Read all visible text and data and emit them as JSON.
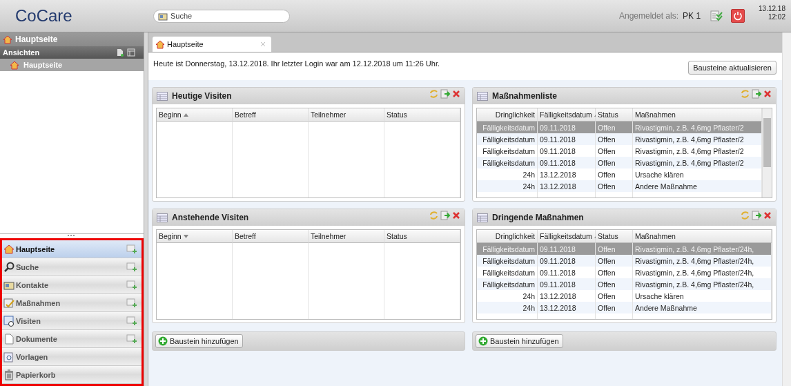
{
  "header": {
    "logo": "CoCare",
    "search": {
      "placeholder": "Suche"
    },
    "login_label": "Angemeldet als:",
    "user": "PK 1",
    "date": "13.12.18",
    "time": "12:02"
  },
  "sidebar": {
    "title": "Hauptseite",
    "views_label": "Ansichten",
    "views": [
      {
        "label": "Hauptseite",
        "selected": true
      }
    ],
    "nav_highlighted": true,
    "nav": [
      {
        "label": "Hauptseite",
        "selected": true,
        "add": true
      },
      {
        "label": "Suche",
        "selected": false,
        "add": true
      },
      {
        "label": "Kontakte",
        "selected": false,
        "add": true
      },
      {
        "label": "Maßnahmen",
        "selected": false,
        "add": true
      },
      {
        "label": "Visiten",
        "selected": false,
        "add": true
      },
      {
        "label": "Dokumente",
        "selected": false,
        "add": true
      },
      {
        "label": "Vorlagen",
        "selected": false,
        "add": false
      },
      {
        "label": "Papierkorb",
        "selected": false,
        "add": false
      }
    ]
  },
  "tabs": [
    {
      "label": "Hauptseite",
      "selected": true
    }
  ],
  "welcome": "Heute ist Donnerstag, 13.12.2018. Ihr letzter Login war am 12.12.2018 um 11:26 Uhr.",
  "refresh_button": "Bausteine aktualisieren",
  "columns": [
    {
      "add_button": "Baustein hinzufügen",
      "panels": [
        {
          "title": "Heutige Visiten",
          "kind": "visits",
          "scrollbar": false,
          "columns": [
            {
              "label": "Beginn",
              "sorted": true,
              "descending": false
            },
            {
              "label": "Betreff",
              "sorted": false
            },
            {
              "label": "Teilnehmer",
              "sorted": false
            },
            {
              "label": "Status",
              "sorted": false
            }
          ]
        },
        {
          "title": "Anstehende Visiten",
          "kind": "visits",
          "scrollbar": false,
          "columns": [
            {
              "label": "Beginn",
              "sorted": true,
              "descending": true
            },
            {
              "label": "Betreff",
              "sorted": false
            },
            {
              "label": "Teilnehmer",
              "sorted": false
            },
            {
              "label": "Status",
              "sorted": false
            }
          ]
        }
      ]
    },
    {
      "add_button": "Baustein hinzufügen",
      "panels": [
        {
          "title": "Maßnahmenliste",
          "kind": "measures",
          "scrollbar": true,
          "columns": [
            {
              "label": "Dringlichkeit",
              "sorted": false
            },
            {
              "label": "Fälligkeitsdatum",
              "sorted": true,
              "descending": false
            },
            {
              "label": "Status",
              "sorted": false
            },
            {
              "label": "Maßnahmen",
              "sorted": false
            }
          ],
          "rows": [
            {
              "cells": [
                "Fälligkeitsdatum",
                "09.11.2018",
                "Offen",
                "Rivastigmin, z.B. 4,6mg Pflaster/2"
              ],
              "selected": true
            },
            {
              "cells": [
                "Fälligkeitsdatum",
                "09.11.2018",
                "Offen",
                "Rivastigmin, z.B. 4,6mg Pflaster/2"
              ],
              "selected": false
            },
            {
              "cells": [
                "Fälligkeitsdatum",
                "09.11.2018",
                "Offen",
                "Rivastigmin, z.B. 4,6mg Pflaster/2"
              ],
              "selected": false
            },
            {
              "cells": [
                "Fälligkeitsdatum",
                "09.11.2018",
                "Offen",
                "Rivastigmin, z.B. 4,6mg Pflaster/2"
              ],
              "selected": false
            },
            {
              "cells": [
                "24h",
                "13.12.2018",
                "Offen",
                "Ursache klären"
              ],
              "selected": false
            },
            {
              "cells": [
                "24h",
                "13.12.2018",
                "Offen",
                "Andere Maßnahme"
              ],
              "selected": false
            }
          ]
        },
        {
          "title": "Dringende Maßnahmen",
          "kind": "measures",
          "scrollbar": false,
          "columns": [
            {
              "label": "Dringlichkeit",
              "sorted": false
            },
            {
              "label": "Fälligkeitsdatum",
              "sorted": true,
              "descending": false
            },
            {
              "label": "Status",
              "sorted": false
            },
            {
              "label": "Maßnahmen",
              "sorted": false
            }
          ],
          "rows": [
            {
              "cells": [
                "Fälligkeitsdatum",
                "09.11.2018",
                "Offen",
                "Rivastigmin, z.B. 4,6mg Pflaster/24h,"
              ],
              "selected": true
            },
            {
              "cells": [
                "Fälligkeitsdatum",
                "09.11.2018",
                "Offen",
                "Rivastigmin, z.B. 4,6mg Pflaster/24h,"
              ],
              "selected": false
            },
            {
              "cells": [
                "Fälligkeitsdatum",
                "09.11.2018",
                "Offen",
                "Rivastigmin, z.B. 4,6mg Pflaster/24h,"
              ],
              "selected": false
            },
            {
              "cells": [
                "Fälligkeitsdatum",
                "09.11.2018",
                "Offen",
                "Rivastigmin, z.B. 4,6mg Pflaster/24h,"
              ],
              "selected": false
            },
            {
              "cells": [
                "24h",
                "13.12.2018",
                "Offen",
                "Ursache klären"
              ],
              "selected": false
            },
            {
              "cells": [
                "24h",
                "13.12.2018",
                "Offen",
                "Andere Maßnahme"
              ],
              "selected": false
            }
          ]
        }
      ]
    }
  ]
}
